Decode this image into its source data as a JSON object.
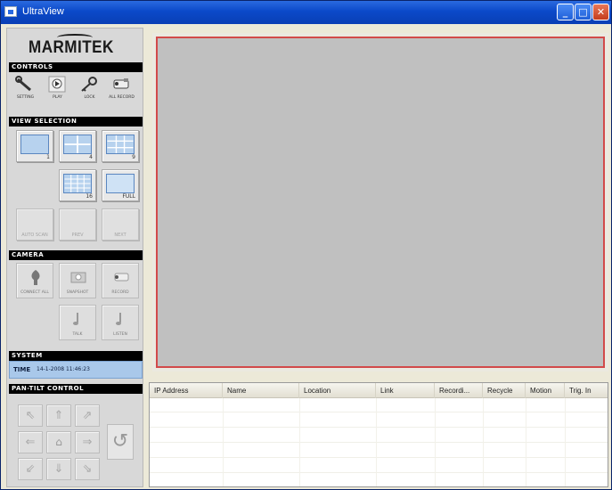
{
  "window": {
    "title": "UltraView",
    "min": "_",
    "max": "□",
    "close": "✕"
  },
  "logo": {
    "text": "MARMITEK"
  },
  "sections": {
    "controls": "CONTROLS",
    "view_selection": "VIEW SELECTION",
    "camera": "CAMERA",
    "system": "SYSTEM",
    "ptz": "PAN-TILT CONTROL"
  },
  "controls": [
    {
      "label": "SETTING",
      "icon": "wrench-icon"
    },
    {
      "label": "PLAY",
      "icon": "play-icon"
    },
    {
      "label": "LOCK",
      "icon": "key-icon"
    },
    {
      "label": "ALL RECORD",
      "icon": "camera-record-icon"
    }
  ],
  "views": [
    {
      "count": "1"
    },
    {
      "count": "4"
    },
    {
      "count": "9"
    },
    {
      "count": "16"
    },
    {
      "count": "FULL"
    }
  ],
  "view_disabled": [
    {
      "label": "AUTO SCAN"
    },
    {
      "label": "PREV"
    },
    {
      "label": "NEXT"
    }
  ],
  "camera": [
    {
      "label": "CONNECT ALL",
      "icon": "connect-icon"
    },
    {
      "label": "SNAPSHOT",
      "icon": "snapshot-icon"
    },
    {
      "label": "RECORD",
      "icon": "record-camera-icon"
    },
    {
      "label": "TALK",
      "icon": "talk-icon"
    },
    {
      "label": "LISTEN",
      "icon": "listen-icon"
    }
  ],
  "system": {
    "time_label": "TIME",
    "time_value": "14-1-2008 11:46:23"
  },
  "ptz": {
    "up_left": "⇖",
    "up": "⇑",
    "up_right": "⇗",
    "left": "⇐",
    "home": "⌂",
    "right": "⇒",
    "down_left": "⇙",
    "down": "⇓",
    "down_right": "⇘",
    "rotate": "↺"
  },
  "table": {
    "columns": [
      "IP Address",
      "Name",
      "Location",
      "Link",
      "Recordi...",
      "Recycle",
      "Motion",
      "Trig. In"
    ]
  },
  "colors": {
    "video_border": "#d24a4a",
    "video_bg": "#c0c0c0",
    "system_bar": "#a9c8ea"
  }
}
